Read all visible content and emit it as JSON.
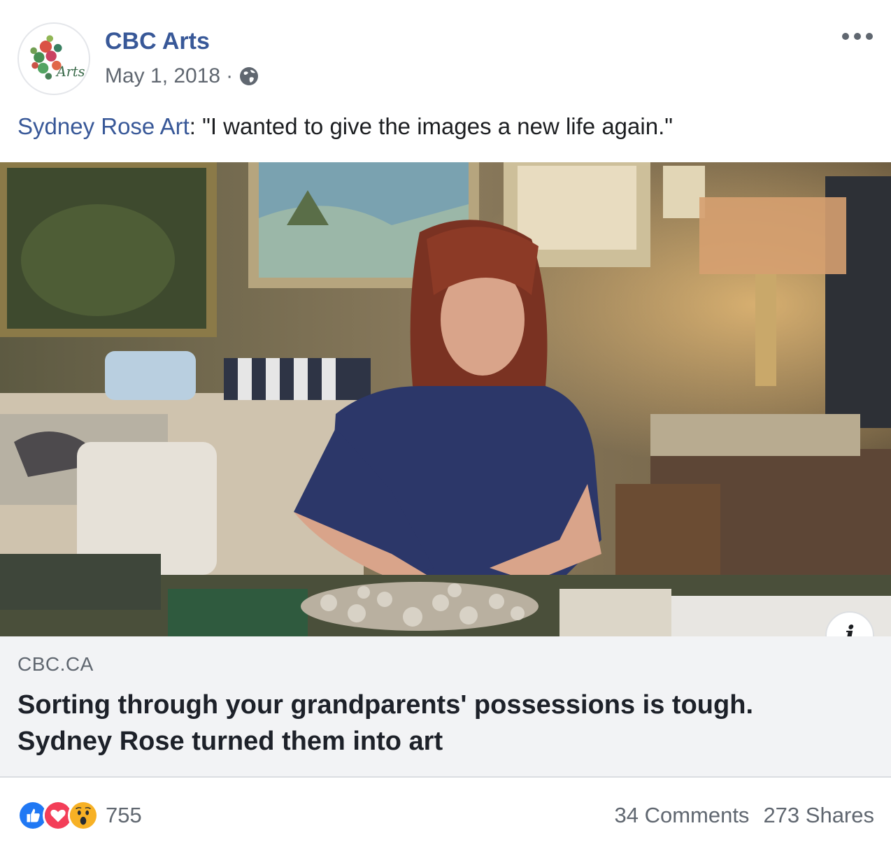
{
  "post": {
    "page_name": "CBC Arts",
    "date": "May 1, 2018",
    "separator": "·",
    "audience_icon": "globe-icon",
    "more_icon": "more-options-icon",
    "avatar_text": "Arts",
    "caption": {
      "mention": "Sydney Rose Art",
      "text": ": \"I wanted to give the images a new life again.\""
    }
  },
  "link_preview": {
    "domain": "CBC.CA",
    "title": "Sorting through your grandparents' possessions is tough. Sydney Rose turned them into art",
    "info_label": "i"
  },
  "footer": {
    "reactions": [
      "like-icon",
      "love-icon",
      "wow-icon"
    ],
    "reaction_count": "755",
    "comments": "34 Comments",
    "shares": "273 Shares"
  },
  "colors": {
    "link_blue": "#385898",
    "secondary_text": "#606770",
    "like_blue": "#2078f4",
    "love_red": "#f33e58",
    "wow_yellow": "#f7b125",
    "preview_bg": "#f2f3f5"
  }
}
